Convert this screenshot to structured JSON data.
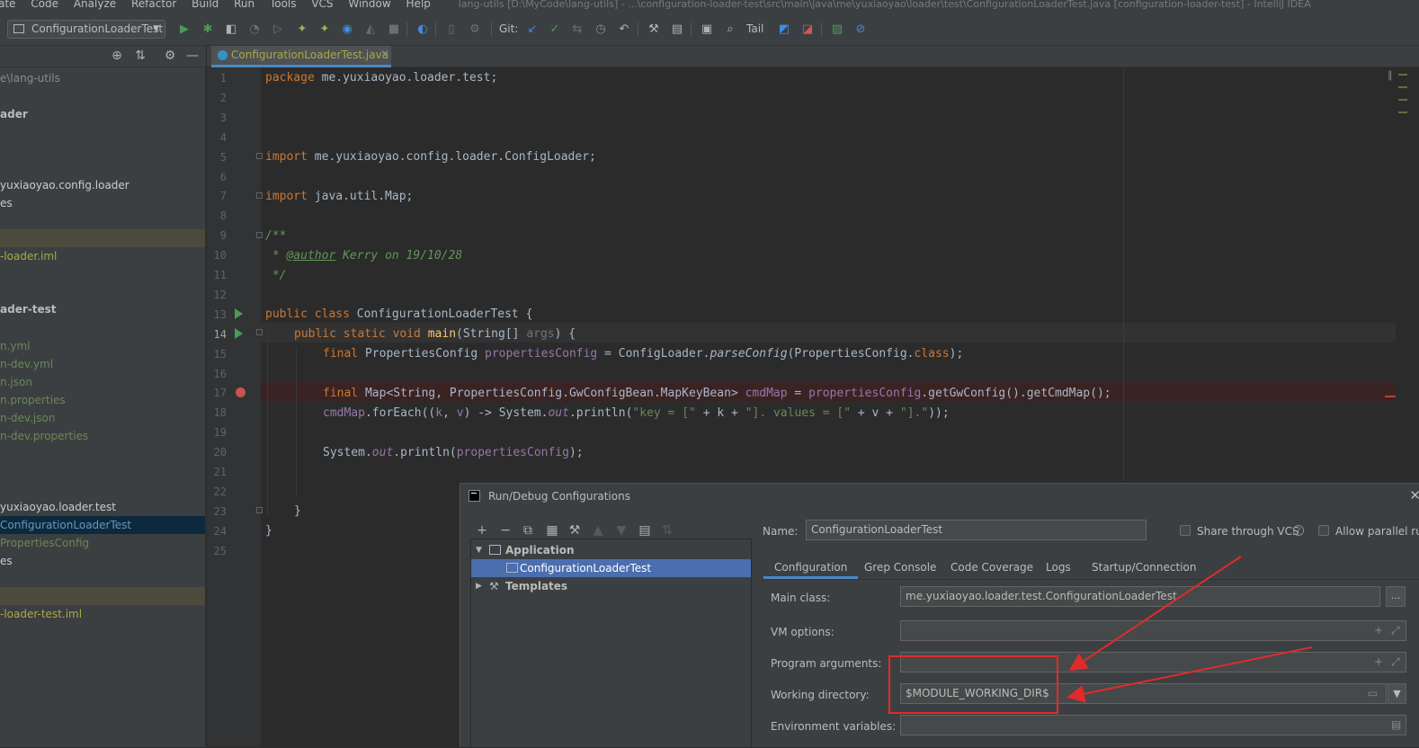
{
  "menu": {
    "items": [
      "ate",
      "Code",
      "Analyze",
      "Refactor",
      "Build",
      "Run",
      "Tools",
      "VCS",
      "Window",
      "Help"
    ],
    "window_title": "lang-utils [D:\\MyCode\\lang-utils] - ...\\configuration-loader-test\\src\\main\\java\\me\\yuxiaoyao\\loader\\test\\ConfigurationLoaderTest.java [configuration-loader-test] - IntelliJ IDEA"
  },
  "toolbar": {
    "run_config": "ConfigurationLoaderTest",
    "git_label": "Git:",
    "tail_label": "Tail"
  },
  "project_tree": [
    {
      "text": "e\\lang-utils",
      "color": "c-gray",
      "bold": false
    },
    {
      "text": "ader",
      "bold": true
    },
    {
      "text": "yuxiaoyao.config.loader",
      "color": "c-blue",
      "bold": false
    },
    {
      "text": "es",
      "color": "c-blue",
      "bold": false
    },
    {
      "text": "",
      "hl": true
    },
    {
      "text": "-loader.iml",
      "color": "c-yellow"
    },
    {
      "text": "ader-test",
      "bold": true
    },
    {
      "text": "n.yml",
      "color": "c-green"
    },
    {
      "text": "n-dev.yml",
      "color": "c-green"
    },
    {
      "text": "n.json",
      "color": "c-green"
    },
    {
      "text": "n.properties",
      "color": "c-green"
    },
    {
      "text": "n-dev.json",
      "color": "c-green"
    },
    {
      "text": "n-dev.properties",
      "color": "c-green"
    },
    {
      "text": "yuxiaoyao.loader.test",
      "color": "c-blue"
    },
    {
      "text": "ConfigurationLoaderTest",
      "color": "c-sel",
      "sel": true
    },
    {
      "text": "PropertiesConfig",
      "color": "c-green"
    },
    {
      "text": "es",
      "color": "c-blue"
    },
    {
      "text": "",
      "hl": true
    },
    {
      "text": "-loader-test.iml",
      "color": "c-yellow"
    }
  ],
  "editor": {
    "tab_label": "ConfigurationLoaderTest.java",
    "line_numbers": [
      "1",
      "2",
      "3",
      "4",
      "5",
      "6",
      "7",
      "8",
      "9",
      "10",
      "11",
      "12",
      "13",
      "14",
      "15",
      "16",
      "17",
      "18",
      "19",
      "20",
      "21",
      "22",
      "23",
      "24",
      "25"
    ],
    "current_line": "14",
    "breakpoint_line": "17",
    "code": {
      "l1_kw": "package",
      "l1_rest": " me.yuxiaoyao.loader.test;",
      "l5_kw": "import",
      "l5_rest": " me.yuxiaoyao.config.loader.ConfigLoader;",
      "l7_kw": "import",
      "l7_rest": " java.util.Map;",
      "l9": "/**",
      "l10_a": " * ",
      "l10_tag": "@author",
      "l10_b": " Kerry on 19/10/28",
      "l11": " */",
      "l13_kw": "public class",
      "l13_rest": " ConfigurationLoaderTest {",
      "l14_kw": "public static void",
      "l14_fn": "main",
      "l14_rest": "(String[] ",
      "l14_arg": "args",
      "l14_end": ") {",
      "l15_kw": "final",
      "l15_type": " PropertiesConfig ",
      "l15_var": "propertiesConfig",
      "l15_eq": " = ConfigLoader.",
      "l15_call": "parseConfig",
      "l15_arg": "(PropertiesConfig.",
      "l15_cls": "class",
      "l15_end": ");",
      "l17_kw": "final",
      "l17_type": " Map<String, PropertiesConfig.GwConfigBean.MapKeyBean> ",
      "l17_var": "cmdMap",
      "l17_eq": " = ",
      "l17_var2": "propertiesConfig",
      "l17_end": ".getGwConfig().getCmdMap();",
      "l18_var": "cmdMap",
      "l18_a": ".forEach((",
      "l18_k": "k",
      "l18_c": ", ",
      "l18_v": "v",
      "l18_b": ") -> System.",
      "l18_out": "out",
      "l18_c2": ".println(",
      "l18_s1": "\"key = [\"",
      "l18_p1": " + k + ",
      "l18_s2": "\"]. values = [\"",
      "l18_p2": " + v + ",
      "l18_s3": "\"].\"",
      "l18_end": "));",
      "l20_a": "System.",
      "l20_out": "out",
      "l20_b": ".println(",
      "l20_var": "propertiesConfig",
      "l20_end": ");",
      "l23": "}",
      "l24": "}"
    }
  },
  "dialog": {
    "title": "Run/Debug Configurations",
    "tree": {
      "application": "Application",
      "selected": "ConfigurationLoaderTest",
      "templates": "Templates"
    },
    "name_label": "Name:",
    "name_value": "ConfigurationLoaderTest",
    "share_vcs": "Share through VCS",
    "allow_parallel": "Allow parallel ru",
    "tabs": [
      "Configuration",
      "Grep Console",
      "Code Coverage",
      "Logs",
      "Startup/Connection"
    ],
    "main_class_label": "Main class:",
    "main_class_value": "me.yuxiaoyao.loader.test.ConfigurationLoaderTest",
    "vm_options_label": "VM options:",
    "program_args_label": "Program arguments:",
    "working_dir_label": "Working directory:",
    "working_dir_value": "$MODULE_WORKING_DIR$",
    "env_vars_label": "Environment variables:",
    "ellipsis": "..."
  },
  "colors": {
    "annotation": "#e02b2b",
    "accent": "#4a88c7"
  }
}
